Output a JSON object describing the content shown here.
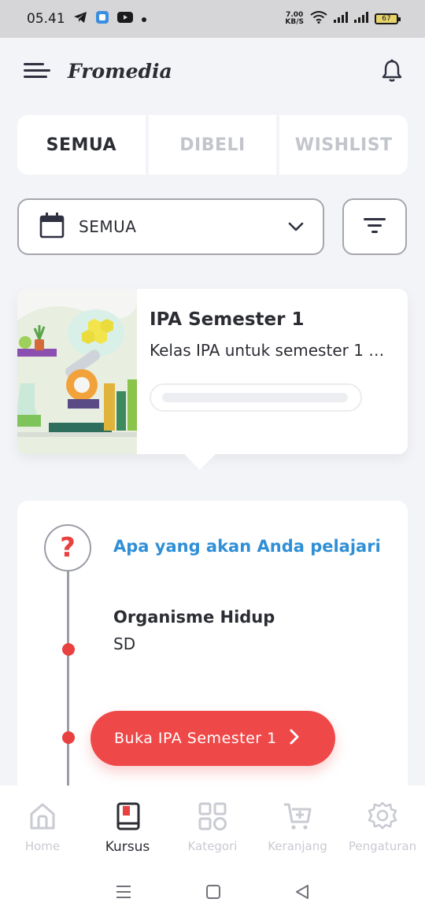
{
  "status_bar": {
    "time": "05.41",
    "net_speed_value": "7.00",
    "net_speed_unit": "KB/S",
    "battery": "67",
    "icons": [
      "telegram-icon",
      "app-icon",
      "youtube-icon",
      "dot-icon",
      "wifi-icon",
      "signal-icon",
      "signal-icon",
      "battery-icon"
    ]
  },
  "header": {
    "brand": "Fromedia",
    "icons": [
      "menu-icon",
      "bell-icon"
    ]
  },
  "tabs": [
    {
      "label": "SEMUA",
      "active": true
    },
    {
      "label": "DIBELI",
      "active": false
    },
    {
      "label": "WISHLIST",
      "active": false
    }
  ],
  "filter": {
    "selected": "SEMUA",
    "icons": [
      "calendar-icon",
      "chevron-down-icon",
      "filter-icon"
    ]
  },
  "course": {
    "title": "IPA Semester 1",
    "description": "Kelas IPA untuk semester 1 …",
    "thumbnail_icon": "science-lab-illustration"
  },
  "learn": {
    "heading": "Apa yang akan Anda pelajari",
    "question_mark": "?",
    "topic_title": "Organisme Hidup",
    "topic_level": "SD"
  },
  "open_button": {
    "label": "Buka IPA Semester 1"
  },
  "bottom_nav": [
    {
      "label": "Home",
      "icon": "home-icon",
      "active": false
    },
    {
      "label": "Kursus",
      "icon": "book-icon",
      "active": true
    },
    {
      "label": "Kategori",
      "icon": "grid-icon",
      "active": false
    },
    {
      "label": "Keranjang",
      "icon": "cart-icon",
      "active": false
    },
    {
      "label": "Pengaturan",
      "icon": "gear-icon",
      "active": false
    }
  ],
  "system_nav": {
    "icons": [
      "recent-apps-icon",
      "home-square-icon",
      "back-icon"
    ]
  },
  "colors": {
    "accent_red": "#ef4848",
    "link_blue": "#2f8fd6",
    "text_dark": "#2b2d33",
    "inactive_gray": "#c9cbd2",
    "background": "#f3f4f8"
  }
}
